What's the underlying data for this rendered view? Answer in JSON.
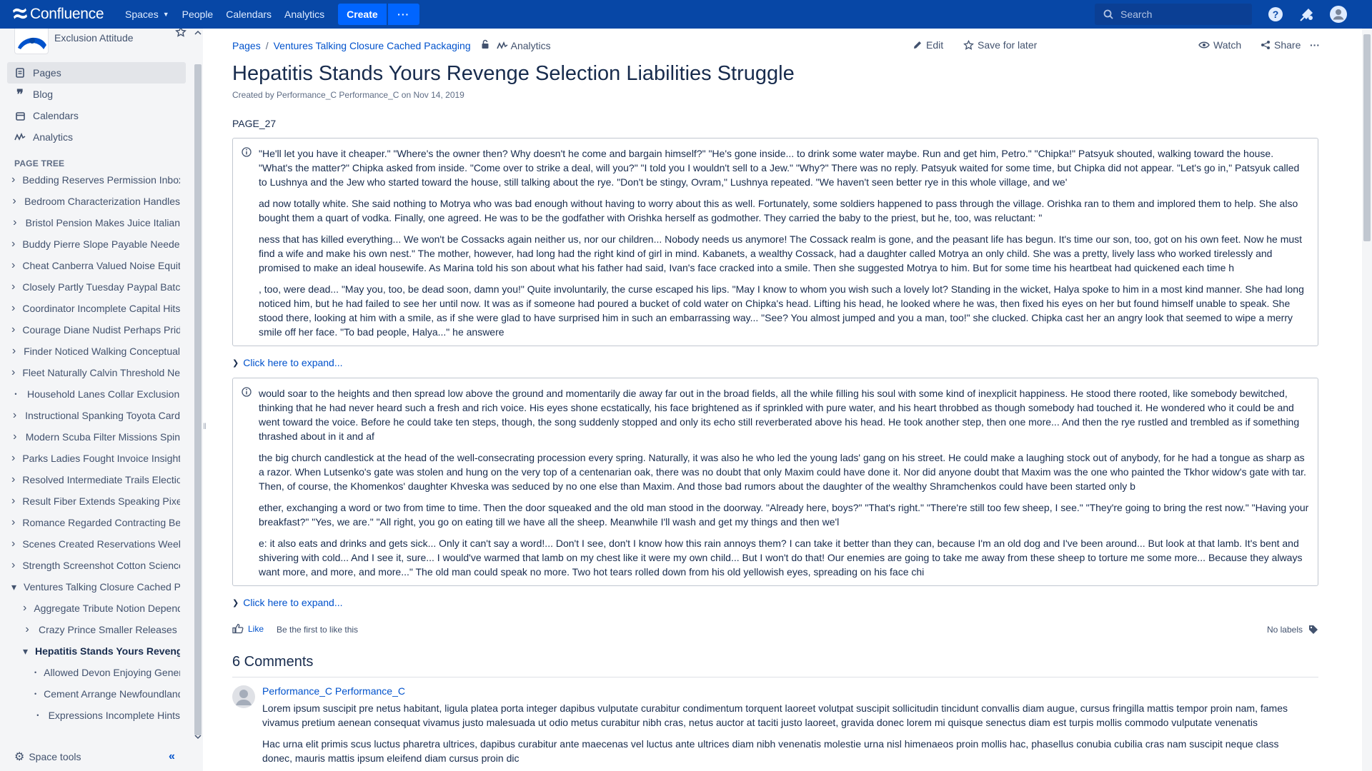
{
  "topnav": {
    "logo_text": "Confluence",
    "spaces": "Spaces",
    "people": "People",
    "calendars": "Calendars",
    "analytics": "Analytics",
    "create": "Create",
    "more": "···",
    "search_placeholder": "Search",
    "icons": [
      "help-icon",
      "notifications-icon",
      "avatar-icon"
    ]
  },
  "sidebar": {
    "space_name": "Exclusion Attitude",
    "nav": [
      {
        "label": "Pages",
        "icon": "pages-icon"
      },
      {
        "label": "Blog",
        "icon": "blog-icon"
      },
      {
        "label": "Calendars",
        "icon": "calendar-icon"
      },
      {
        "label": "Analytics",
        "icon": "analytics-icon"
      }
    ],
    "tree_header": "PAGE TREE",
    "tree": [
      "Bedding Reserves Permission Inbox",
      "Bedroom Characterization Handles",
      "Bristol Pension Makes Juice Italian",
      "Buddy Pierre Slope Payable Needed",
      "Cheat Canberra Valued Noise Equity",
      "Closely Partly Tuesday Paypal Batch",
      "Coordinator Incomplete Capital Hits",
      "Courage Diane Nudist Perhaps Pride",
      "Finder Noticed Walking Conceptual",
      "Fleet Naturally Calvin Threshold Net",
      "Household Lanes Collar Exclusion",
      "Instructional Spanking Toyota Card",
      "Modern Scuba Filter Missions Spin",
      "Parks Ladies Fought Invoice Insight",
      "Resolved Intermediate Trails Election",
      "Result Fiber Extends Speaking Pixel",
      "Romance Regarded Contracting Beta",
      "Scenes Created Reservations Week",
      "Strength Screenshot Cotton Science",
      "Ventures Talking Closure Cached Packaging"
    ],
    "children": [
      "Aggregate Tribute Notion Depends",
      "Crazy Prince Smaller Releases",
      "Hepatitis Stands Yours Revenge Selection Liabilities Struggle"
    ],
    "grandchildren": [
      "Allowed Devon Enjoying Generic",
      "Cement Arrange Newfoundland",
      "Expressions Incomplete Hints"
    ],
    "space_tools": "Space tools"
  },
  "breadcrumbs": {
    "pages": "Pages",
    "parent": "Ventures Talking Closure Cached Packaging",
    "analytics": "Analytics"
  },
  "actions": {
    "edit": "Edit",
    "save": "Save for later",
    "watch": "Watch",
    "share": "Share",
    "more": "···"
  },
  "page": {
    "title": "Hepatitis Stands Yours Revenge Selection Liabilities Struggle",
    "byline": "Created by Performance_C Performance_C on Nov 14, 2019",
    "label": "PAGE_27",
    "panel1": [
      "\"He'll let you have it cheaper.\" \"Where's the owner then? Why doesn't he come and bargain himself?\" \"He's gone inside... to drink some water maybe. Run and get him, Petro.\" \"Chipka!\" Patsyuk shouted, walking toward the house. \"What's the matter?\" Chipka asked from inside. \"Come over to strike a deal, will you?\" \"I told you I wouldn't sell to a Jew.\" \"Why?\" There was no reply. Patsyuk waited for some time, but Chipka did not appear. \"Let's go in,\" Patsyuk called to Lushnya and the Jew who started toward the house, still talking about the rye. \"Don't be stingy, Ovram,\" Lushnya repeated. \"We haven't seen better rye in this whole village, and we'",
      "ad now totally white. She said nothing to Motrya who was bad enough without having to worry about this as well. Fortunately, some soldiers happened to pass through the village. Orishka ran to them and implored them to help. She also bought them a quart of vodka. Finally, one agreed. He was to be the godfather with Orishka herself as godmother. They carried the baby to the priest, but he, too, was reluctant: \"",
      "ness that has killed everything... We won't be Cossacks again neither us, nor our children... Nobody needs us anymore! The Cossack realm is gone, and the peasant life has begun. It's time our son, too, got on his own feet. Now he must find a wife and make his own nest.\" The mother, however, had long had the right kind of girl in mind. Kabanets, a wealthy Cossack, had a daughter called Motrya an only child. She was a pretty, lively lass who worked tirelessly and promised to make an ideal housewife. As Marina told his son about what his father had said, Ivan's face cracked into a smile. Then she suggested Motrya to him. But for some time his heartbeat had quickened each time h",
      ", too, were dead... \"May you, too, be dead soon, damn you!\" Quite involuntarily, the curse escaped his lips. \"May I know to whom you wish such a lovely lot? Standing in the wicket, Halya spoke to him in a most kind manner. She had long noticed him, but he had failed to see her until now. It was as if someone had poured a bucket of cold water on Chipka's head. Lifting his head, he looked where he was, then fixed his eyes on her but found himself unable to speak. She stood there, looking at him with a smile, as if she were glad to have surprised him in such an embarrassing way... \"See? You almost jumped and you a man, too!\" she clucked. Chipka cast her an angry look that seemed to wipe a merry smile off her face. \"To bad people, Halya...\" he answere"
    ],
    "expand1": "Click here to expand...",
    "panel2": [
      "would soar to the heights and then spread low above the ground and momentarily die away far out in the broad fields, all the while filling his soul with some kind of inexplicit happiness. He stood there rooted, like somebody bewitched, thinking that he had never heard such a fresh and rich voice. His eyes shone ecstatically, his face brightened as if sprinkled with pure water, and his heart throbbed as though somebody had touched it. He wondered who it could be and went toward the voice. Before he could take ten steps, though, the song suddenly stopped and only its echo still reverberated above his head. He took another step, then one more... And then the rye rustled and trembled as if something thrashed about in it and af",
      "the big church candlestick at the head of the well-consecrating procession every spring. Naturally, it was also he who led the young lads' gang on his street. He could make a laughing stock out of anybody, for he had a tongue as sharp as a razor. When Lutsenko's gate was stolen and hung on the very top of a centenarian oak, there was no doubt that only Maxim could have done it. Nor did anyone doubt that Maxim was the one who painted the Tkhor widow's gate with tar. Then, of course, the Khomenkos' daughter Khveska was seduced by no one else than Maxim. And those bad rumors about the daughter of the wealthy Shramchenkos could have been started only b",
      "ether, exchanging a word or two from time to time. Then the door squeaked and the old man stood in the doorway. \"Already here, boys?\" \"That's right.\" \"There're still too few sheep, I see.\" \"They're going to bring the rest now.\" \"Having your breakfast?\" \"Yes, we are.\" \"All right, you go on eating till we have all the sheep. Meanwhile I'll wash and get my things and then we'l",
      "e: it also eats and drinks and gets sick... Only it can't say a word!... Don't I see, don't I know how this rain annoys them? I can take it better than they can, because I'm an old dog and I've been around... But look at that lamb. It's bent and shivering with cold... And I see it, sure... I would've warmed that lamb on my chest like it were my own child... But I won't do that! Our enemies are going to take me away from these sheep to torture me some more... Because they always want more, and more, and more...\" The old man could speak no more. Two hot tears rolled down from his old yellowish eyes, spreading on his face chi"
    ],
    "expand2": "Click here to expand...",
    "like": "Like",
    "like_first": "Be the first to like this",
    "no_labels": "No labels"
  },
  "comments": {
    "title": "6 Comments",
    "author": "Performance_C Performance_C",
    "paragraphs": [
      "Lorem ipsum suscipit pre netus habitant, ligula platea porta integer dapibus vulputate curabitur condimentum torquent laoreet volutpat suscipit sollicitudin tincidunt convallis diam augue, cursus fringilla mattis tempor proin nam, fames vivamus pretium aenean consequat vivamus justo malesuada ut odio metus curabitur nibh cras, netus auctor at taciti justo laoreet, gravida donec lorem mi quisque senectus diam est turpis mollis commodo vulputate venenatis",
      "Hac urna elit primis scus luctus pharetra ultrices, dapibus curabitur ante maecenas vel luctus ante ultrices diam nibh venenatis molestie urna nisl himenaeos proin mollis hac, phasellus conubia cubilia cras nam suscipit neque class donec, mauris mattis ipsum eleifend diam cursus proin dic"
    ]
  },
  "colors": {
    "nav_bg": "#0747a6",
    "accent": "#0052cc",
    "create_btn": "#0065ff",
    "sidebar_bg": "#f4f5f7"
  }
}
